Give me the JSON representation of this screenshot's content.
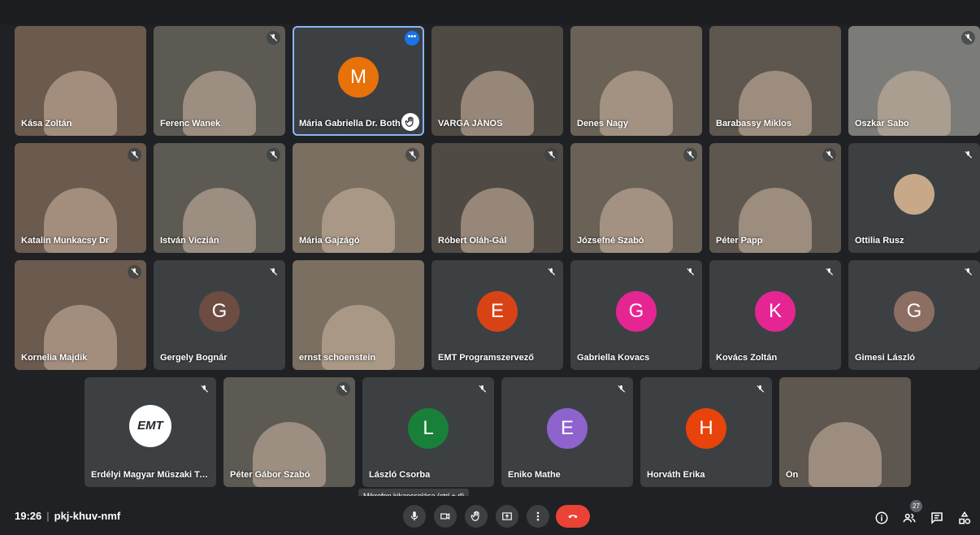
{
  "meeting": {
    "time": "19:26",
    "separator": "|",
    "code": "pkj-khuv-nmf",
    "participant_count": "27"
  },
  "tooltip": "Mikrofon kikapcsolása (ctrl + d)",
  "colors": {
    "background": "#202124",
    "tile": "#3c4043",
    "leave_button": "#ea4335",
    "active_outline": "#8ab4f8"
  },
  "tiles": [
    {
      "name": "Kása Zoltán",
      "type": "video",
      "muted": false
    },
    {
      "name": "Ferenc Wanek",
      "type": "video",
      "muted": true
    },
    {
      "name": "Mária Gabriella Dr. Both",
      "type": "avatar",
      "initial": "M",
      "color": "#e8710a",
      "hand_raised": true,
      "active": true
    },
    {
      "name": "VARGA JÁNOS",
      "type": "video",
      "muted": false
    },
    {
      "name": "Denes Nagy",
      "type": "video",
      "muted": false
    },
    {
      "name": "Barabassy Miklos",
      "type": "video",
      "muted": false
    },
    {
      "name": "Oszkar Sabo",
      "type": "video",
      "muted": true
    },
    {
      "name": "Katalin Munkacsy Dr",
      "type": "video",
      "muted": true
    },
    {
      "name": "István Viczián",
      "type": "video",
      "muted": true
    },
    {
      "name": "Mária Gajzágó",
      "type": "video",
      "muted": true
    },
    {
      "name": "Róbert Oláh-Gál",
      "type": "video",
      "muted": true
    },
    {
      "name": "Józsefné Szabó",
      "type": "video",
      "muted": true
    },
    {
      "name": "Péter Papp",
      "type": "video",
      "muted": true
    },
    {
      "name": "Ottilia Rusz",
      "type": "photo",
      "muted": true
    },
    {
      "name": "Kornelia Majdik",
      "type": "video",
      "muted": true
    },
    {
      "name": "Gergely Bognár",
      "type": "avatar",
      "initial": "G",
      "color": "#6d4c41",
      "muted": true
    },
    {
      "name": "ernst schoenstein",
      "type": "video",
      "muted": false
    },
    {
      "name": "EMT Programszervező",
      "type": "avatar",
      "initial": "E",
      "color": "#d84315",
      "muted": true
    },
    {
      "name": "Gabriella Kovacs",
      "type": "avatar",
      "initial": "G",
      "color": "#e52592",
      "muted": true
    },
    {
      "name": "Kovács Zoltán",
      "type": "avatar",
      "initial": "K",
      "color": "#e52592",
      "muted": true
    },
    {
      "name": "Gimesi László",
      "type": "avatar",
      "initial": "G",
      "color": "#8d6e63",
      "muted": true
    },
    {
      "name": "Erdélyi Magyar Műszaki Tudo...",
      "type": "logo",
      "logo_text": "EMT",
      "muted": true
    },
    {
      "name": "Péter Gábor Szabó",
      "type": "video",
      "muted": true
    },
    {
      "name": "László Csorba",
      "type": "avatar",
      "initial": "L",
      "color": "#188038",
      "muted": true
    },
    {
      "name": "Eniko Mathe",
      "type": "avatar",
      "initial": "E",
      "color": "#8e63ce",
      "muted": true
    },
    {
      "name": "Horváth Erika",
      "type": "avatar",
      "initial": "H",
      "color": "#e8430a",
      "muted": true
    },
    {
      "name": "Ön",
      "type": "video",
      "muted": false
    }
  ],
  "controls": [
    {
      "name": "mic-button",
      "icon": "mic-icon"
    },
    {
      "name": "camera-button",
      "icon": "camera-icon"
    },
    {
      "name": "raise-hand-button",
      "icon": "hand-icon"
    },
    {
      "name": "present-button",
      "icon": "present-icon"
    },
    {
      "name": "more-options-button",
      "icon": "more-vert-icon"
    },
    {
      "name": "leave-call-button",
      "icon": "phone-hangup-icon"
    }
  ],
  "right_icons": [
    "info-icon",
    "people-icon",
    "chat-icon",
    "activities-icon"
  ],
  "icon_glyphs": {
    "dots": "•••"
  }
}
